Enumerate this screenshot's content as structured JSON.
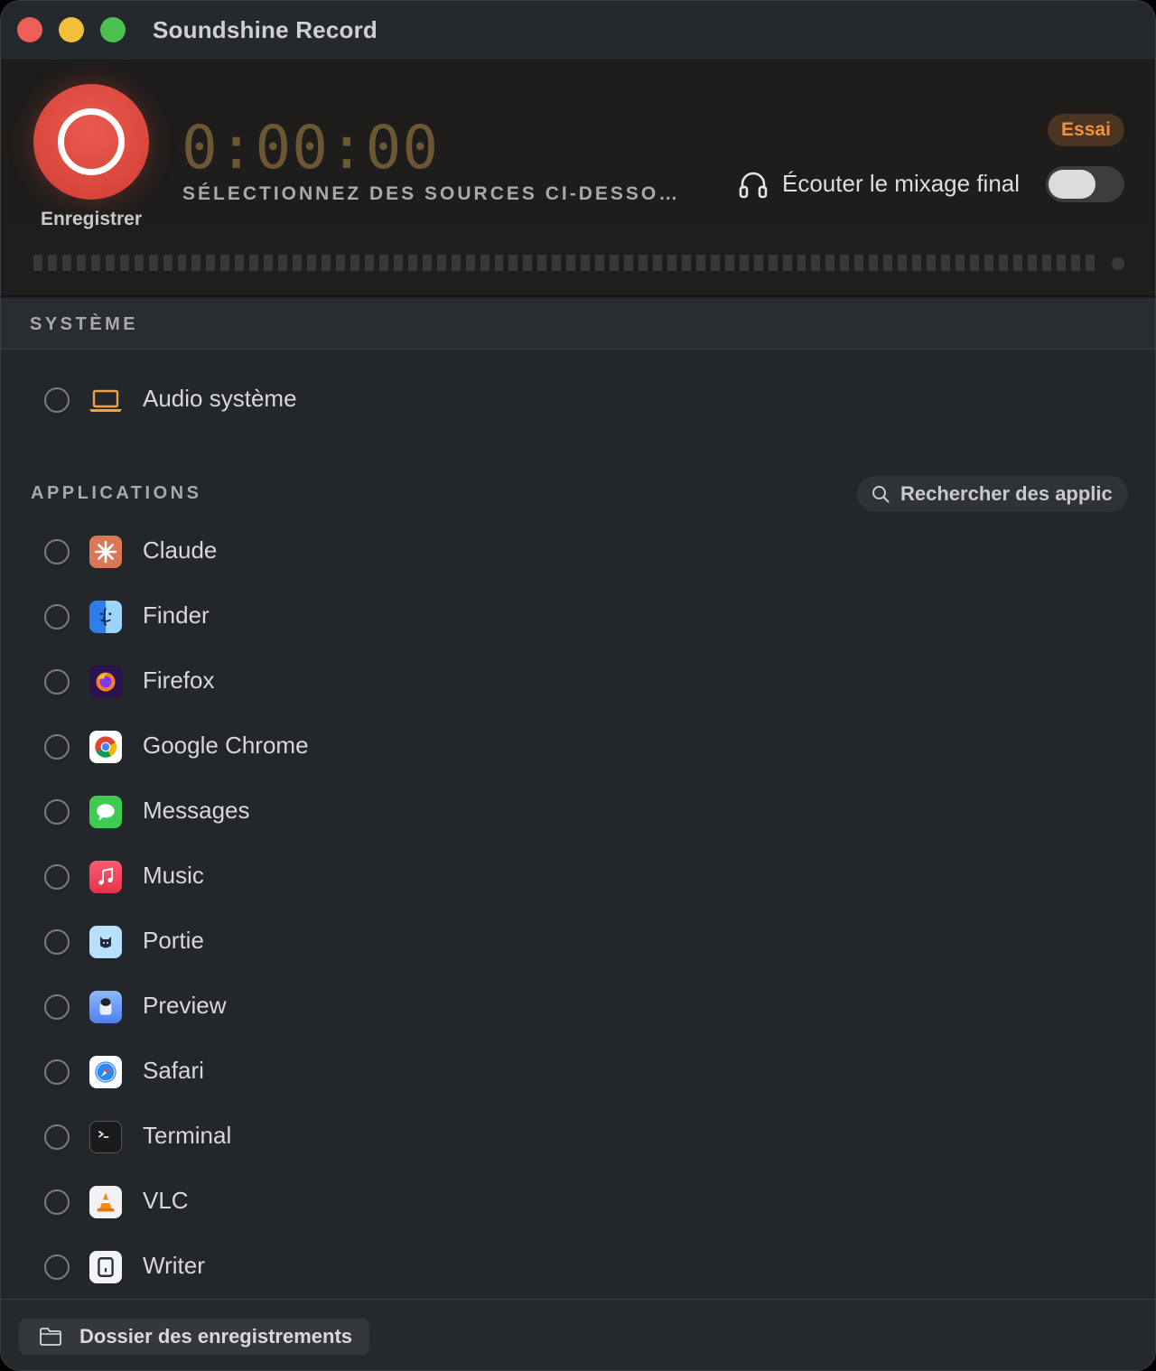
{
  "window": {
    "title": "Soundshine Record"
  },
  "header": {
    "record_label": "Enregistrer",
    "timer": "0:00:00",
    "status": "SÉLECTIONNEZ DES SOURCES CI-DESSO…",
    "badge": "Essai",
    "monitor_label": "Écouter le mixage final",
    "monitor_enabled": false
  },
  "system": {
    "title": "SYSTÈME",
    "items": [
      {
        "label": "Audio système",
        "icon": "laptop-icon"
      }
    ]
  },
  "applications": {
    "title": "APPLICATIONS",
    "search_placeholder": "Rechercher des applic",
    "items": [
      {
        "label": "Claude",
        "icon": "claude-icon",
        "color": "#d97757"
      },
      {
        "label": "Finder",
        "icon": "finder-icon",
        "color": "#3d8ef0"
      },
      {
        "label": "Firefox",
        "icon": "firefox-icon",
        "color": "#4b1a8a"
      },
      {
        "label": "Google Chrome",
        "icon": "chrome-icon",
        "color": "#ffffff"
      },
      {
        "label": "Messages",
        "icon": "messages-icon",
        "color": "#3fcb52"
      },
      {
        "label": "Music",
        "icon": "music-icon",
        "color": "#f0405a"
      },
      {
        "label": "Portie",
        "icon": "portie-icon",
        "color": "#8ec8f5"
      },
      {
        "label": "Preview",
        "icon": "preview-icon",
        "color": "#5a8cf0"
      },
      {
        "label": "Safari",
        "icon": "safari-icon",
        "color": "#ffffff"
      },
      {
        "label": "Terminal",
        "icon": "terminal-icon",
        "color": "#1e1e1e"
      },
      {
        "label": "VLC",
        "icon": "vlc-icon",
        "color": "#f3f3f3"
      },
      {
        "label": "Writer",
        "icon": "writer-icon",
        "color": "#f5f5f5"
      }
    ]
  },
  "footer": {
    "folder_label": "Dossier des enregistrements"
  }
}
